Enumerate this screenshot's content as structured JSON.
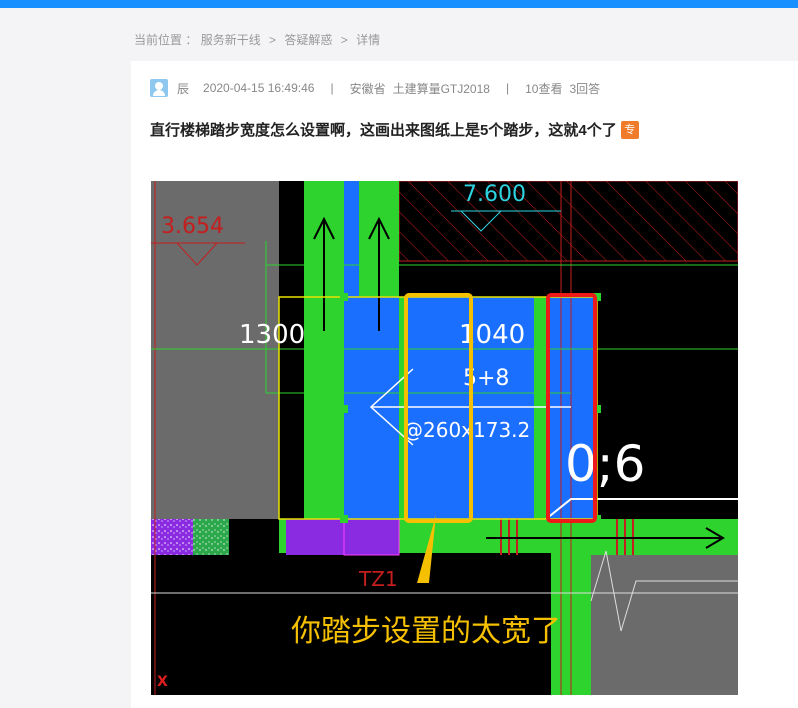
{
  "breadcrumb": {
    "label": "当前位置 ：",
    "items": [
      "服务新干线",
      "答疑解惑",
      "详情"
    ],
    "separator": ">"
  },
  "post": {
    "author": "辰",
    "datetime": "2020-04-15 16:49:46",
    "region": "安徽省",
    "software": "土建算量GTJ2018",
    "views": "10查看",
    "answers": "3回答",
    "title": "直行楼梯踏步宽度怎么设置啊，这画出来图纸上是5个踏步，这就4个了",
    "badge": "专"
  },
  "drawing": {
    "elevation_left": "3.654",
    "elevation_top": "7.600",
    "dim_left": "1300",
    "dim_right": "1040",
    "note_steps": "5+8",
    "note_spacing": "@260x173.2",
    "big_label": "0;6",
    "beam_label": "TZ1",
    "axis_label": "X",
    "annotation": "你踏步设置的太宽了"
  },
  "colors": {
    "accent": "#1890ff",
    "cad_green": "#2ed32e",
    "cad_blue": "#1a6fff",
    "highlight_yellow": "#f5c000",
    "highlight_red": "#ee1a1a",
    "badge_orange": "#f07c2a"
  }
}
